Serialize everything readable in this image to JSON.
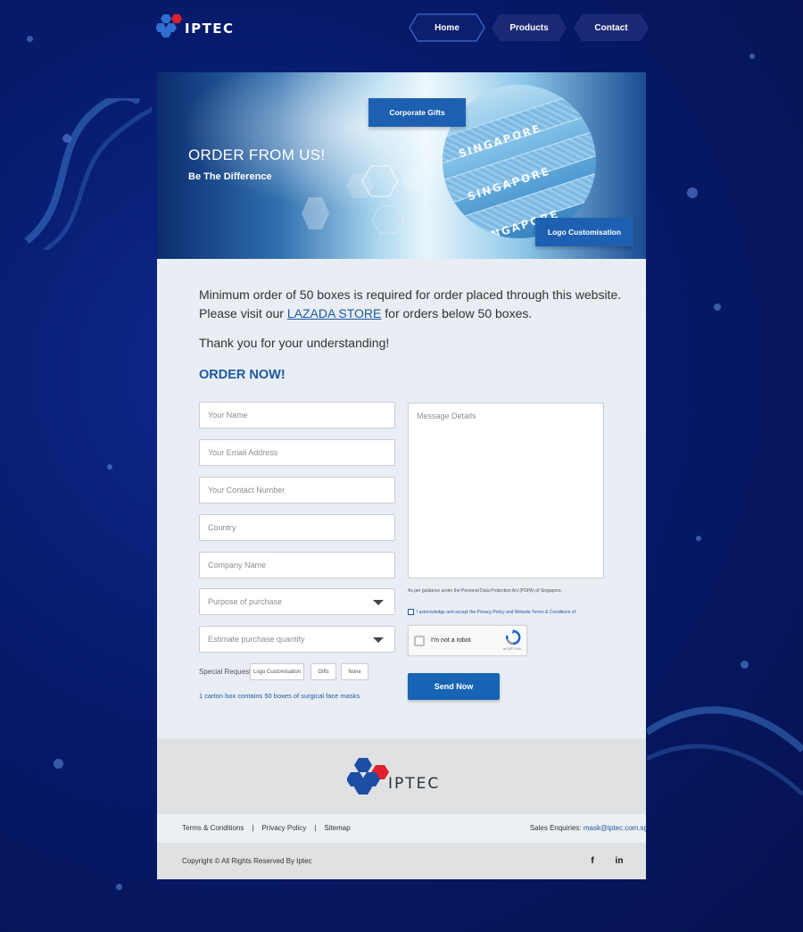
{
  "header": {
    "logo_text": "IPTEC",
    "nav": [
      {
        "label": "Home",
        "active": true
      },
      {
        "label": "Products",
        "active": false
      },
      {
        "label": "Contact",
        "active": false
      }
    ]
  },
  "hero": {
    "title": "ORDER FROM US!",
    "subtitle": "Be The Difference",
    "mask_labels": [
      "SINGAPORE",
      "SINGAPORE",
      "SINGAPORE"
    ],
    "buttons": {
      "corporate_gifts": "Corporate Gifts",
      "logo_customisation": "Logo Customisation"
    }
  },
  "intro": {
    "line1": "Minimum order of 50 boxes is required for order placed through this website.",
    "line2_before": "Please visit our ",
    "line2_link": "LAZADA STORE",
    "line2_after": " for orders below 50 boxes.",
    "thanks": "Thank you for your understanding!",
    "order_heading": "ORDER NOW!"
  },
  "form": {
    "name_placeholder": "Your Name",
    "email_placeholder": "Your Email Address",
    "contact_placeholder": "Your Contact Number",
    "country_placeholder": "Country",
    "company_placeholder": "Company Name",
    "purpose_select": "Purpose of purchase",
    "quantity_select": "Estimate purchase quantity",
    "message_placeholder": "Message Details",
    "pdpa_text": "As per guidance under the Personal Data Protection Act (PDPA) of Singapore,",
    "consent_text": "I acknowledge and accept the Privacy Policy and Website Terms & Conditions of",
    "captcha_label": "I'm not a robot",
    "captcha_brand": "reCAPTCHA",
    "special_request_label": "Special Request",
    "special_options": [
      "Logo Customisation",
      "Gifts",
      "None"
    ],
    "carton_note": "1 carton box contains 50 boxes of surgical face masks",
    "submit_label": "Send Now"
  },
  "footer": {
    "logo_text": "IPTEC",
    "links": [
      "Terms & Conditions",
      "Privacy Policy",
      "Sitemap"
    ],
    "sales_label": "Sales Enquiries: ",
    "sales_email": "mask@iptec.com.sg",
    "copyright": "Copyright © All Rights Reserved By Iptec",
    "social": {
      "facebook": "f",
      "linkedin": "in"
    }
  },
  "colors": {
    "brand_blue": "#1f5aa0",
    "button_blue": "#1764b5",
    "logo_red": "#e0202d",
    "logo_blue": "#1c4fa3",
    "background_navy": "#071a6b"
  },
  "icons": [
    "logo-hexagon-icon",
    "chevron-down-icon",
    "recaptcha-icon",
    "facebook-icon",
    "linkedin-icon"
  ]
}
